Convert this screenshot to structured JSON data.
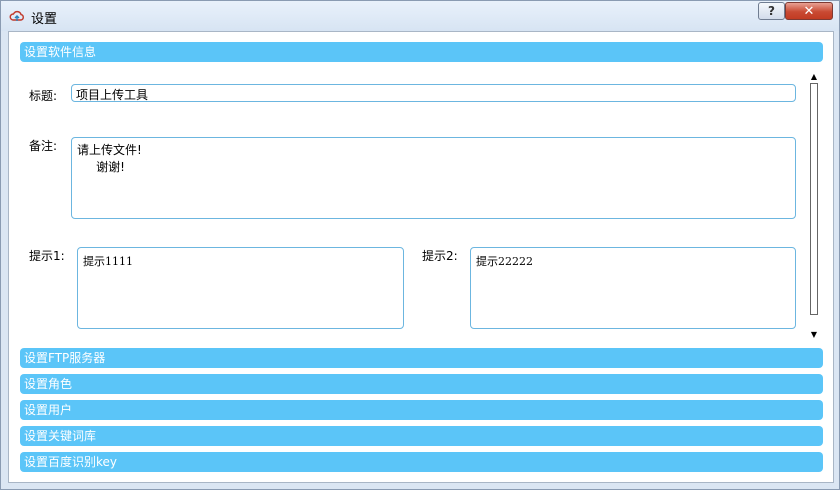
{
  "window": {
    "title": "设置",
    "blurred_text": ""
  },
  "titlebar": {
    "help_label": "?",
    "close_label": "✕"
  },
  "software_info": {
    "header": "设置软件信息",
    "title_label": "标题:",
    "title_value": "项目上传工具",
    "remark_label": "备注:",
    "remark_value": "请上传文件!\n     谢谢!",
    "hint1_label": "提示1:",
    "hint1_value": "提示1111",
    "hint2_label": "提示2:",
    "hint2_value": "提示22222"
  },
  "sections": [
    {
      "label": "设置FTP服务器"
    },
    {
      "label": "设置角色"
    },
    {
      "label": "设置用户"
    },
    {
      "label": "设置关键词库"
    },
    {
      "label": "设置百度识别key"
    }
  ],
  "scrollbar": {
    "up_glyph": "▲",
    "down_glyph": "▼"
  }
}
